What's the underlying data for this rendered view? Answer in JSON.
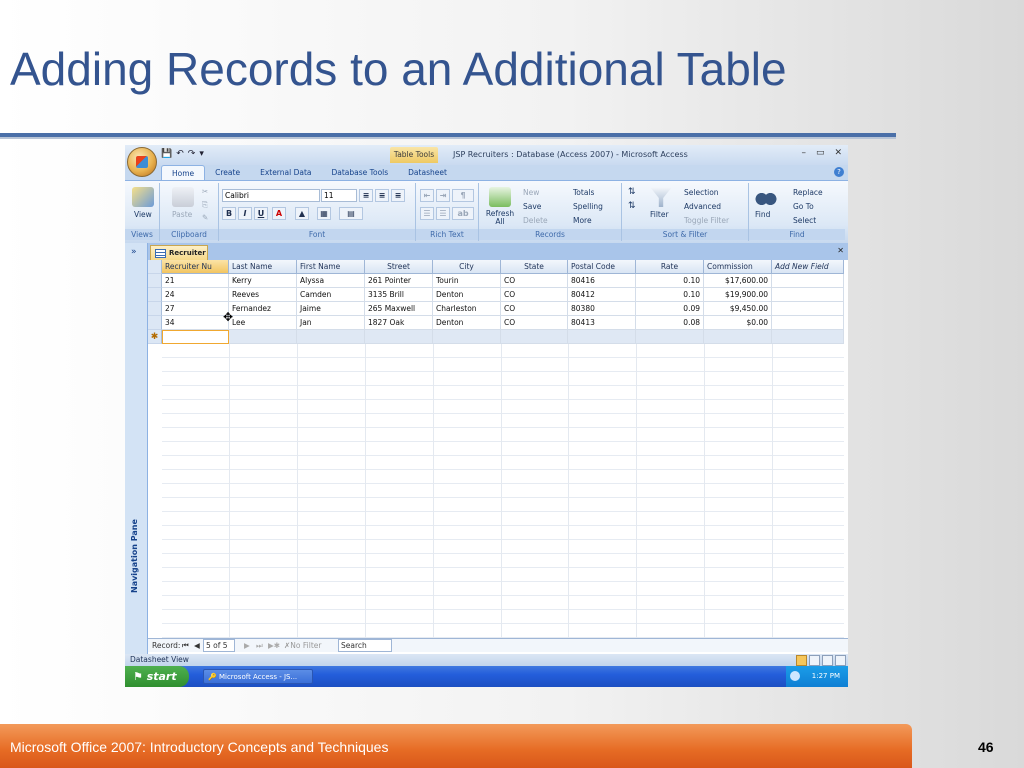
{
  "slide": {
    "title": "Adding Records to an Additional Table",
    "footer": "Microsoft Office 2007: Introductory Concepts and Techniques",
    "page_number": "46"
  },
  "window": {
    "contextual_tab_label": "Table Tools",
    "title": "JSP Recruiters : Database (Access 2007) - Microsoft Access",
    "controls": [
      "–",
      "▭",
      "✕"
    ]
  },
  "tabs": [
    "Home",
    "Create",
    "External Data",
    "Database Tools",
    "Datasheet"
  ],
  "ribbon": {
    "views": {
      "view_label": "View",
      "group": "Views"
    },
    "clipboard": {
      "paste_label": "Paste",
      "group": "Clipboard"
    },
    "font": {
      "name": "Calibri",
      "size": "11",
      "bold": "B",
      "italic": "I",
      "underline": "U",
      "font_color": "A",
      "group": "Font"
    },
    "rich_text": {
      "group": "Rich Text"
    },
    "records": {
      "refresh_label": "Refresh All",
      "new_label": "New",
      "save_label": "Save",
      "delete_label": "Delete",
      "totals_label": "Totals",
      "spelling_label": "Spelling",
      "more_label": "More",
      "group": "Records"
    },
    "sort_filter": {
      "filter_label": "Filter",
      "selection_label": "Selection",
      "advanced_label": "Advanced",
      "toggle_label": "Toggle Filter",
      "group": "Sort & Filter"
    },
    "find": {
      "find_label": "Find",
      "replace_label": "Replace",
      "goto_label": "Go To",
      "select_label": "Select",
      "group": "Find"
    }
  },
  "document": {
    "tab_label": "Recruiter",
    "nav_pane_label": "Navigation Pane",
    "columns": [
      "Recruiter Nu",
      "Last Name",
      "First Name",
      "Street",
      "City",
      "State",
      "Postal Code",
      "Rate",
      "Commission",
      "Add New Field"
    ],
    "rows": [
      [
        "21",
        "Kerry",
        "Alyssa",
        "261 Pointer",
        "Tourin",
        "CO",
        "80416",
        "0.10",
        "$17,600.00"
      ],
      [
        "24",
        "Reeves",
        "Camden",
        "3135 Brill",
        "Denton",
        "CO",
        "80412",
        "0.10",
        "$19,900.00"
      ],
      [
        "27",
        "Fernandez",
        "Jaime",
        "265 Maxwell",
        "Charleston",
        "CO",
        "80380",
        "0.09",
        "$9,450.00"
      ],
      [
        "34",
        "Lee",
        "Jan",
        "1827 Oak",
        "Denton",
        "CO",
        "80413",
        "0.08",
        "$0.00"
      ]
    ],
    "new_row_marker": "✱"
  },
  "record_nav": {
    "label": "Record:",
    "position": "5 of 5",
    "filter_label": "No Filter",
    "search_label": "Search"
  },
  "status": {
    "view_label": "Datasheet View"
  },
  "taskbar": {
    "start_label": "start",
    "task_label": "Microsoft Access - JS...",
    "clock": "1:27 PM"
  }
}
